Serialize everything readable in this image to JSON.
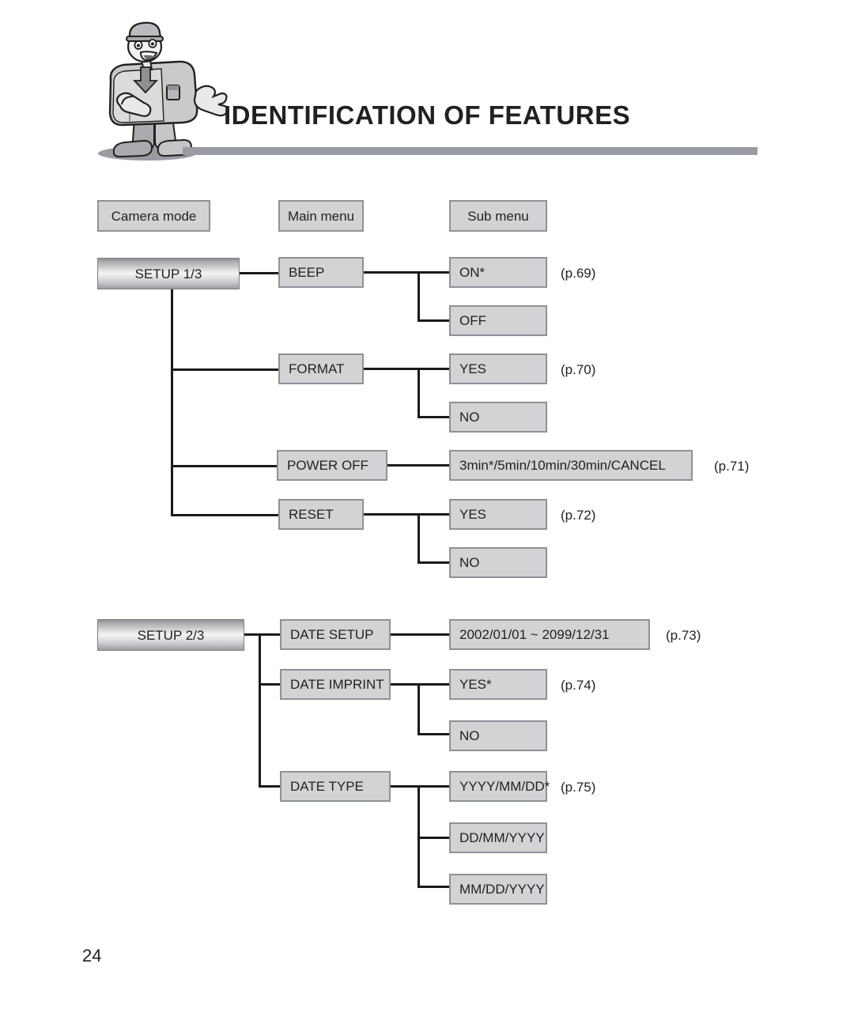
{
  "header": {
    "title": "IDENTIFICATION OF FEATURES",
    "mascot_icon": "camera-mascot-character"
  },
  "column_headers": [
    {
      "label": "Camera mode"
    },
    {
      "label": "Main menu"
    },
    {
      "label": "Sub menu"
    }
  ],
  "sections": [
    {
      "mode": "SETUP 1/3",
      "menus": [
        {
          "main": "BEEP",
          "page_ref": "(p.69)",
          "subs": [
            "ON*",
            "OFF"
          ]
        },
        {
          "main": "FORMAT",
          "page_ref": "(p.70)",
          "subs": [
            "YES",
            "NO"
          ]
        },
        {
          "main": "POWER OFF",
          "page_ref": "(p.71)",
          "subs": [
            "3min*/5min/10min/30min/CANCEL"
          ]
        },
        {
          "main": "RESET",
          "page_ref": "(p.72)",
          "subs": [
            "YES",
            "NO"
          ]
        }
      ]
    },
    {
      "mode": "SETUP 2/3",
      "menus": [
        {
          "main": "DATE SETUP",
          "page_ref": "(p.73)",
          "subs": [
            "2002/01/01 ~ 2099/12/31"
          ]
        },
        {
          "main": "DATE IMPRINT",
          "page_ref": "(p.74)",
          "subs": [
            "YES*",
            "NO"
          ]
        },
        {
          "main": "DATE TYPE",
          "page_ref": "(p.75)",
          "subs": [
            "YYYY/MM/DD*",
            "DD/MM/YYYY",
            "MM/DD/YYYY"
          ]
        }
      ]
    }
  ],
  "footer": {
    "page_number": "24"
  },
  "colors": {
    "box_fill": "#d2d3d5",
    "box_border": "#8e9196",
    "rule": "#9a9ca3",
    "text": "#231f20",
    "line": "#1a1a1a"
  }
}
